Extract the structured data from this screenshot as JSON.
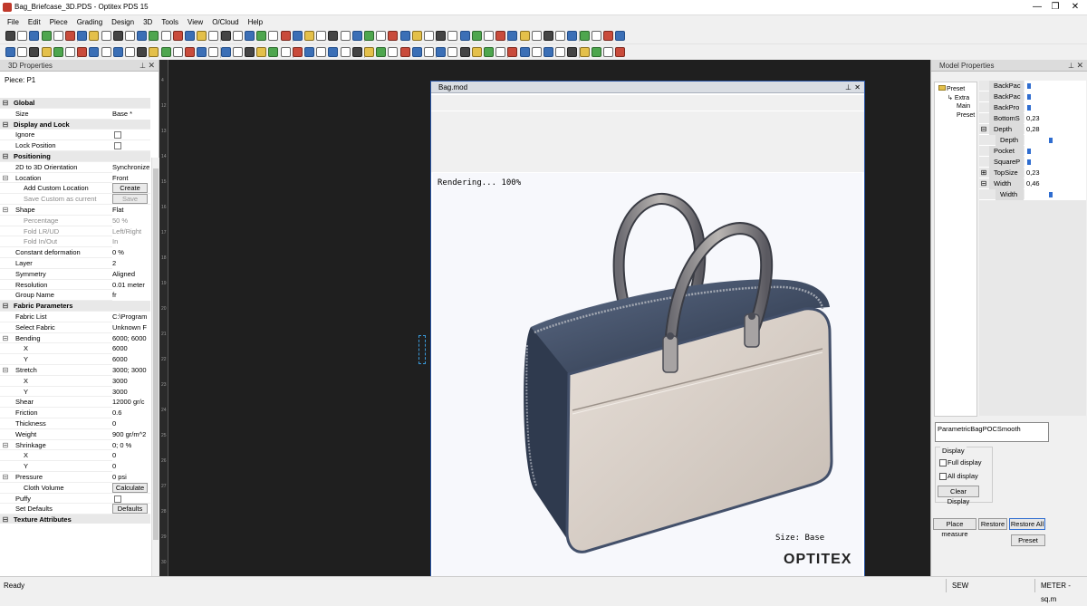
{
  "window": {
    "title": "Bag_Briefcase_3D.PDS - Optitex PDS 15",
    "minimize": "—",
    "restore": "❐",
    "close": "✕"
  },
  "menu": [
    "File",
    "Edit",
    "Piece",
    "Grading",
    "Design",
    "3D",
    "Tools",
    "View",
    "O/Cloud",
    "Help"
  ],
  "props_panel": {
    "title": "3D Properties",
    "piece": "Piece: P1",
    "rows": [
      {
        "type": "cat",
        "exp": "⊟",
        "name": "Global"
      },
      {
        "type": "prop",
        "name": "Size",
        "value": "Base *"
      },
      {
        "type": "cat",
        "exp": "⊟",
        "name": "Display and Lock"
      },
      {
        "type": "check",
        "name": "Ignore"
      },
      {
        "type": "check",
        "name": "Lock Position"
      },
      {
        "type": "cat",
        "exp": "⊟",
        "name": "Positioning"
      },
      {
        "type": "prop",
        "name": "2D to 3D Orientation",
        "value": "Synchronize"
      },
      {
        "type": "prop",
        "exp": "⊟",
        "name": "Location",
        "value": "Front"
      },
      {
        "type": "button",
        "sub": true,
        "name": "Add Custom Location",
        "value": "Create"
      },
      {
        "type": "button",
        "sub": true,
        "gray": true,
        "name": "Save Custom as current",
        "value": "Save"
      },
      {
        "type": "prop",
        "exp": "⊟",
        "name": "Shape",
        "value": "Flat"
      },
      {
        "type": "prop",
        "sub": true,
        "gray": true,
        "name": "Percentage",
        "value": "50 %"
      },
      {
        "type": "prop",
        "sub": true,
        "gray": true,
        "name": "Fold LR/UD",
        "value": "Left/Right"
      },
      {
        "type": "prop",
        "sub": true,
        "gray": true,
        "name": "Fold In/Out",
        "value": "In"
      },
      {
        "type": "prop",
        "name": "Constant deformation",
        "value": "0 %"
      },
      {
        "type": "prop",
        "name": "Layer",
        "value": "2"
      },
      {
        "type": "prop",
        "name": "Symmetry",
        "value": "Aligned"
      },
      {
        "type": "prop",
        "name": "Resolution",
        "value": "0.01 meter"
      },
      {
        "type": "prop",
        "name": "Group Name",
        "value": "fr"
      },
      {
        "type": "cat",
        "exp": "⊟",
        "name": "Fabric Parameters"
      },
      {
        "type": "prop",
        "name": "Fabric List",
        "value": "C:\\Program"
      },
      {
        "type": "prop",
        "name": "Select Fabric",
        "value": "Unknown F"
      },
      {
        "type": "prop",
        "exp": "⊟",
        "name": "Bending",
        "value": "6000; 6000"
      },
      {
        "type": "prop",
        "sub": true,
        "name": "X",
        "value": "6000"
      },
      {
        "type": "prop",
        "sub": true,
        "name": "Y",
        "value": "6000"
      },
      {
        "type": "prop",
        "exp": "⊟",
        "name": "Stretch",
        "value": "3000; 3000"
      },
      {
        "type": "prop",
        "sub": true,
        "name": "X",
        "value": "3000"
      },
      {
        "type": "prop",
        "sub": true,
        "name": "Y",
        "value": "3000"
      },
      {
        "type": "prop",
        "name": "Shear",
        "value": "12000 gr/c"
      },
      {
        "type": "prop",
        "name": "Friction",
        "value": "0.6"
      },
      {
        "type": "prop",
        "name": "Thickness",
        "value": "0"
      },
      {
        "type": "prop",
        "name": "Weight",
        "value": "900 gr/m^2"
      },
      {
        "type": "prop",
        "exp": "⊟",
        "name": "Shrinkage",
        "value": "0; 0 %"
      },
      {
        "type": "prop",
        "sub": true,
        "name": "X",
        "value": "0"
      },
      {
        "type": "prop",
        "sub": true,
        "name": "Y",
        "value": "0"
      },
      {
        "type": "prop",
        "exp": "⊟",
        "name": "Pressure",
        "value": "0 psi"
      },
      {
        "type": "button",
        "sub": true,
        "name": "Cloth Volume",
        "value": "Calculate"
      },
      {
        "type": "check",
        "name": "Puffy"
      },
      {
        "type": "button",
        "name": "Set Defaults",
        "value": "Defaults"
      },
      {
        "type": "cat",
        "exp": "⊟",
        "name": "Texture Attributes"
      }
    ]
  },
  "ruler_ticks": [
    "4",
    "12",
    "13",
    "14",
    "15",
    "16",
    "17",
    "18",
    "19",
    "20",
    "21",
    "22",
    "23",
    "24",
    "25",
    "26",
    "27",
    "28",
    "29",
    "30"
  ],
  "bag_window": {
    "title": "Bag.mod",
    "pin": "⊥",
    "close": "✕",
    "rendering": "Rendering... 100%",
    "size_label": "Size: Base",
    "brand": "OPTITEX"
  },
  "model_panel": {
    "title": "Model Properties",
    "tree": [
      "Preset",
      "Extra",
      "Main",
      "Preset"
    ],
    "rows": [
      {
        "name": "BackPac",
        "slider": true
      },
      {
        "name": "BackPac",
        "slider": true
      },
      {
        "name": "BackPro",
        "slider": true
      },
      {
        "name": "BottomS",
        "value": "0,23"
      },
      {
        "exp": "⊟",
        "name": "Depth",
        "value": "0,28"
      },
      {
        "name": "Depth",
        "indent": true,
        "slider": true,
        "pos": 0.4
      },
      {
        "name": "Pocket",
        "slider": true
      },
      {
        "name": "SquareP",
        "slider": true
      },
      {
        "exp": "⊞",
        "name": "TopSize",
        "value": "0,23"
      },
      {
        "exp": "⊟",
        "name": "Width",
        "value": "0,46"
      },
      {
        "name": "Width",
        "indent": true,
        "slider": true,
        "pos": 0.4
      }
    ],
    "preset_name": "ParametricBagPOCSmooth",
    "display_label": "Display",
    "full_display": "Full display",
    "all_display": "All display",
    "clear_display": "Clear Display",
    "place_measure": "Place measure",
    "restore": "Restore",
    "restore_all": "Restore All",
    "preset_btn": "Preset"
  },
  "status": {
    "text": "Ready",
    "sew": "SEW",
    "units": "METER - sq.m"
  },
  "colors": {
    "workspace": "#1f1f1f",
    "accent": "#2a57a8",
    "bag_dark": "#3d4b63",
    "bag_light": "#dcd3cc"
  }
}
